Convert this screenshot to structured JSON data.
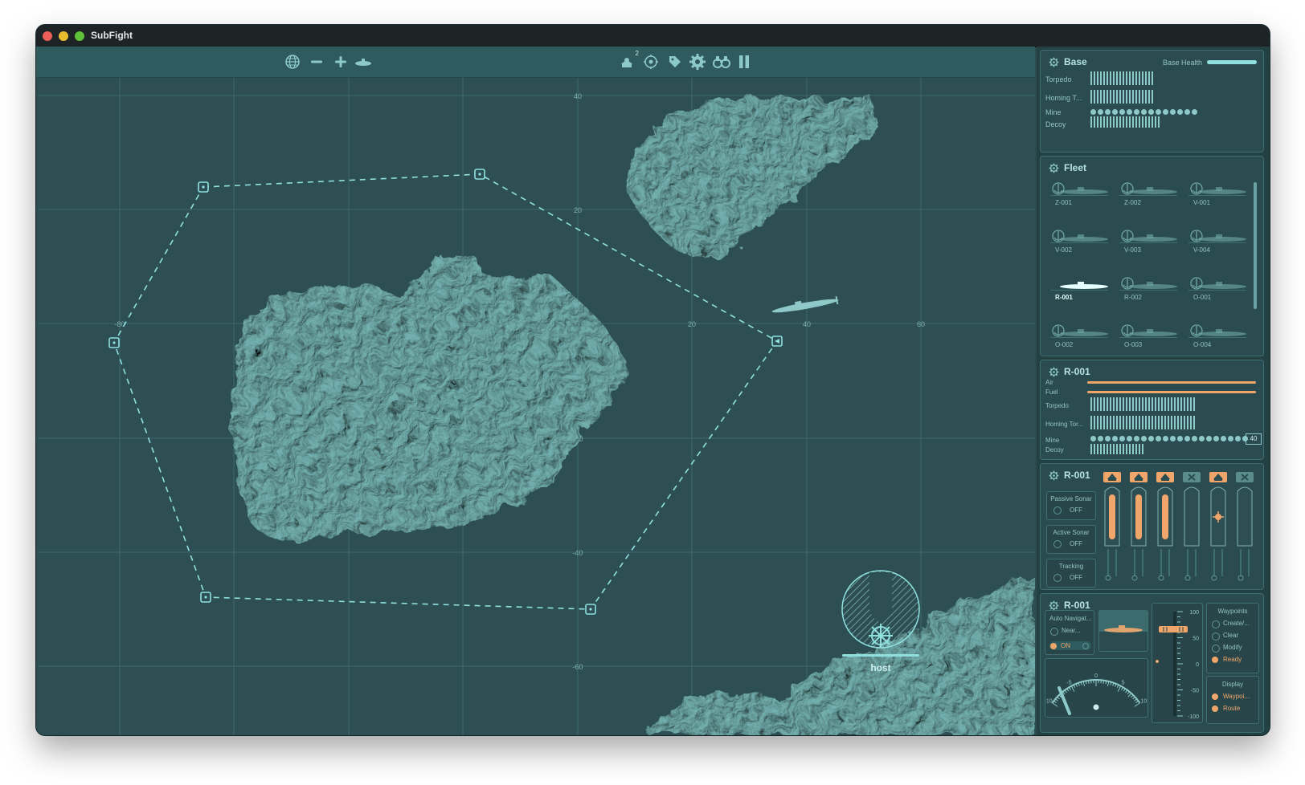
{
  "window": {
    "title": "SubFight"
  },
  "toolbar": {
    "left_icons": [
      "globe-icon",
      "zoom-out-icon",
      "zoom-in-icon",
      "submarine-icon"
    ],
    "right_icons": [
      "captain-icon",
      "crosshair-icon",
      "tag-icon",
      "gear-icon",
      "binoculars-icon",
      "pause-icon"
    ],
    "captain_badge": "2"
  },
  "map": {
    "grid_labels_x": [
      "-80",
      "20",
      "40",
      "60"
    ],
    "grid_labels_y": [
      "40",
      "20",
      "-20",
      "-40",
      "-60"
    ],
    "compass_label": "host"
  },
  "base_panel": {
    "title": "Base",
    "health_label": "Base Health",
    "health": 1.0,
    "rows": [
      {
        "label": "Torpedo",
        "count": 20
      },
      {
        "label": "Homing T...",
        "count": 20
      },
      {
        "label": "Mine",
        "count": 15
      },
      {
        "label": "Decoy",
        "count": 22
      }
    ]
  },
  "fleet_panel": {
    "title": "Fleet",
    "subs": [
      "Z-001",
      "Z-002",
      "V-001",
      "V-002",
      "V-003",
      "V-004",
      "R-001",
      "R-002",
      "O-001",
      "O-002",
      "O-003",
      "O-004"
    ],
    "selected": "R-001"
  },
  "status_panel": {
    "title": "R-001",
    "air_label": "Air",
    "fuel_label": "Fuel",
    "air": 1.0,
    "fuel": 1.0,
    "torpedo_label": "Torpedo",
    "homing_label": "Homing Tor...",
    "mine_label": "Mine",
    "decoy_label": "Decoy",
    "mine_count": "40"
  },
  "weapons_panel": {
    "title": "R-001",
    "passive_sonar": {
      "label": "Passive Sonar",
      "value": "OFF"
    },
    "active_sonar": {
      "label": "Active Sonar",
      "value": "OFF"
    },
    "tracking": {
      "label": "Tracking",
      "value": "OFF"
    }
  },
  "nav_panel": {
    "title": "R-001",
    "auto_nav_label": "Auto Navigat...",
    "near_label": "Near...",
    "on_label": "ON",
    "depth_ticks": [
      "100",
      "50",
      "0",
      "-50",
      "-100"
    ],
    "gauge_ticks": [
      "-10",
      "-5",
      "0",
      "5",
      "10"
    ],
    "waypoints": {
      "title": "Waypoints",
      "items": [
        "Create/...",
        "Clear",
        "Modify",
        "Ready"
      ]
    },
    "display": {
      "title": "Display",
      "items": [
        "Waypoi...",
        "Route"
      ]
    }
  },
  "colors": {
    "accent": "#f0a66b",
    "panel_bg": "#2a4b4f",
    "map_bg": "#2d4f53",
    "land": "#5c9a99",
    "route": "#8fe0df"
  }
}
